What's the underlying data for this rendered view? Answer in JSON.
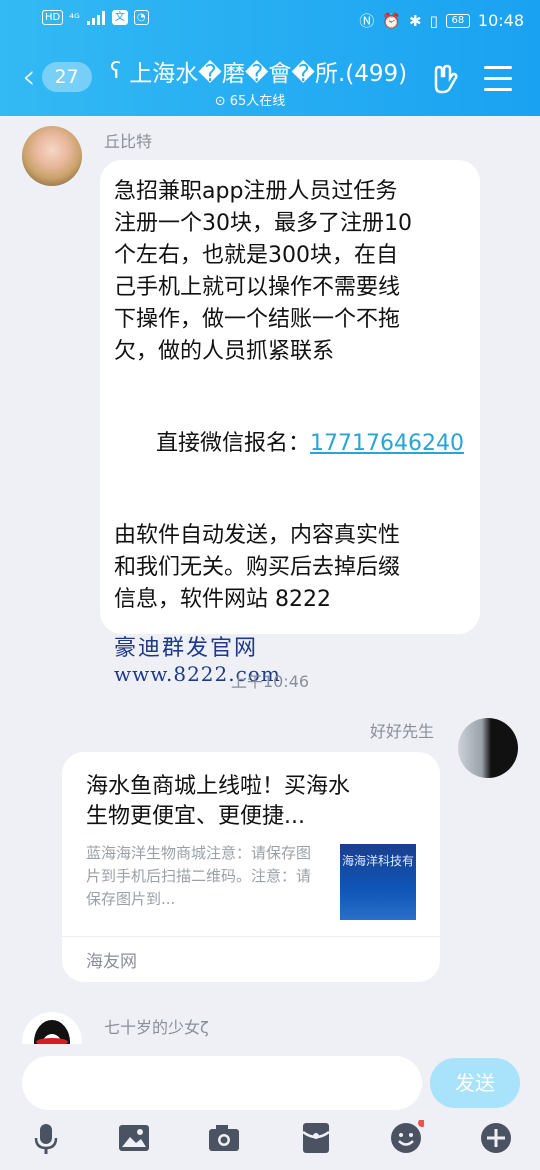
{
  "status_bar": {
    "left_icons": [
      "HD",
      "4G",
      "signal"
    ],
    "network": "⁴ᴳ",
    "battery": "68",
    "time": "10:48"
  },
  "header": {
    "back_count": "27",
    "group_title": "上海水�磨�會�所.(499)",
    "online_text": "65人在线"
  },
  "messages": [
    {
      "sender": "丘比特",
      "text_lines": "急招兼职app注册人员过任务\n注册一个30块，最多了注册10\n个左右，也就是300块，在自\n己手机上就可以操作不需要线\n下操作，做一个结账一个不拖\n欠，做的人员抓紧联系",
      "contact_label": "直接微信报名：",
      "contact_number": "17717646240",
      "disclaimer": "由软件自动发送，内容真实性\n和我们无关。购买后去掉后缀\n信息，软件网站 8222",
      "image_line1": "豪迪群发官网",
      "image_line2": "www.8222.com"
    }
  ],
  "timestamp": "上午10:46",
  "share_card": {
    "sender": "好好先生",
    "title": "海水鱼商城上线啦！买海水\n生物更便宜、更便捷...",
    "description": "蓝海海洋生物商城注意：请保存图片到手机后扫描二维码。注意：请保存图片到...",
    "thumb_text": "海海洋科技有",
    "source": "海友网"
  },
  "next_sender": "七十岁的少女ζ",
  "input": {
    "placeholder": "",
    "send_label": "发送"
  },
  "colors": {
    "header_start": "#33b9f3",
    "header_end": "#1aa2f2",
    "background": "#eef0f6",
    "link": "#2aa3d9",
    "send_disabled": "#a8e2fb"
  }
}
